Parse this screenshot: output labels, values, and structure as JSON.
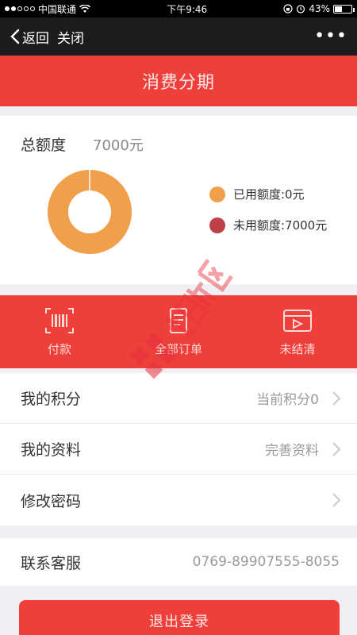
{
  "status_bar": {
    "carrier": "中国联通",
    "time": "下午9:46",
    "battery": "43%",
    "battery_level": 0.43
  },
  "nav": {
    "back_label": "返回",
    "close_label": "关闭",
    "more_label": "•••"
  },
  "header": {
    "title": "消费分期"
  },
  "quota": {
    "label": "总额度",
    "value": "7000元",
    "used_amount": 0,
    "unused_amount": 7000,
    "legend": [
      {
        "label": "已用额度:0元",
        "color": "#f0a04b"
      },
      {
        "label": "未用额度:7000元",
        "color": "#c0404a"
      }
    ]
  },
  "actions": [
    {
      "label": "付款",
      "icon": "barcode-icon"
    },
    {
      "label": "全部订单",
      "icon": "document-icon"
    },
    {
      "label": "未结清",
      "icon": "card-icon"
    }
  ],
  "list": [
    {
      "label": "我的积分",
      "value": "当前积分0"
    },
    {
      "label": "我的资料",
      "value": "完善资料"
    },
    {
      "label": "修改密码",
      "value": ""
    }
  ],
  "contact": {
    "label": "联系客服",
    "value": "0769-89907555-8055"
  },
  "logout": {
    "label": "退出登录"
  },
  "colors": {
    "accent": "#ee3f3b",
    "used": "#f0a04b",
    "unused": "#c0404a"
  }
}
